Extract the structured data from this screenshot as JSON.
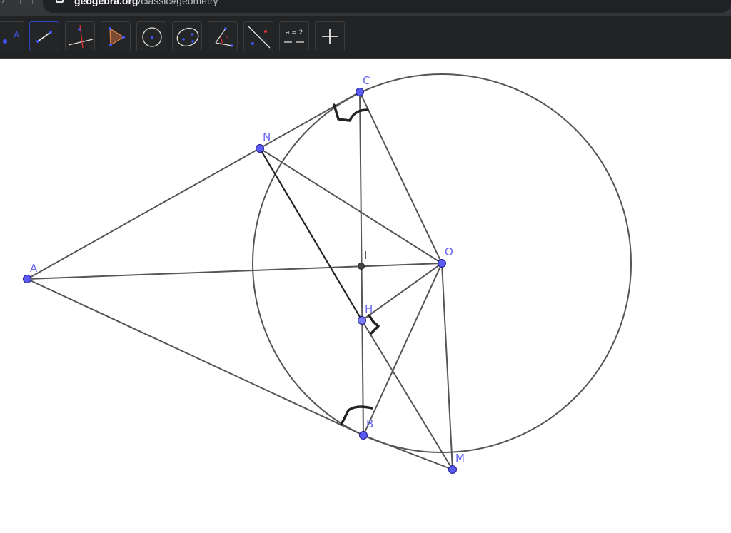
{
  "browser": {
    "url_host": "geogebra.org",
    "url_path": "/classic#geometry"
  },
  "toolbar": {
    "tools": [
      {
        "name": "point-tool",
        "selected": false
      },
      {
        "name": "segment-tool",
        "selected": true
      },
      {
        "name": "perpendicular-line-tool",
        "selected": false
      },
      {
        "name": "polygon-tool",
        "selected": false
      },
      {
        "name": "circle-center-point-tool",
        "selected": false
      },
      {
        "name": "conic-through-points-tool",
        "selected": false
      },
      {
        "name": "angle-tool",
        "selected": false
      },
      {
        "name": "reflect-about-line-tool",
        "selected": false
      },
      {
        "name": "slider-tool",
        "selected": false,
        "label": "a = 2"
      },
      {
        "name": "move-graphics-view-tool",
        "selected": false
      }
    ]
  },
  "colors": {
    "point_fill": "#5b5bf4",
    "point_label": "#6666ee",
    "line": "#555555",
    "toolbar_bg": "#222324",
    "selected_border": "#2f43c7"
  },
  "points": {
    "A": {
      "label": "A"
    },
    "N": {
      "label": "N"
    },
    "C": {
      "label": "C"
    },
    "O": {
      "label": "O"
    },
    "I": {
      "label": "I"
    },
    "H": {
      "label": "H"
    },
    "B": {
      "label": "B"
    },
    "M": {
      "label": "M"
    }
  }
}
